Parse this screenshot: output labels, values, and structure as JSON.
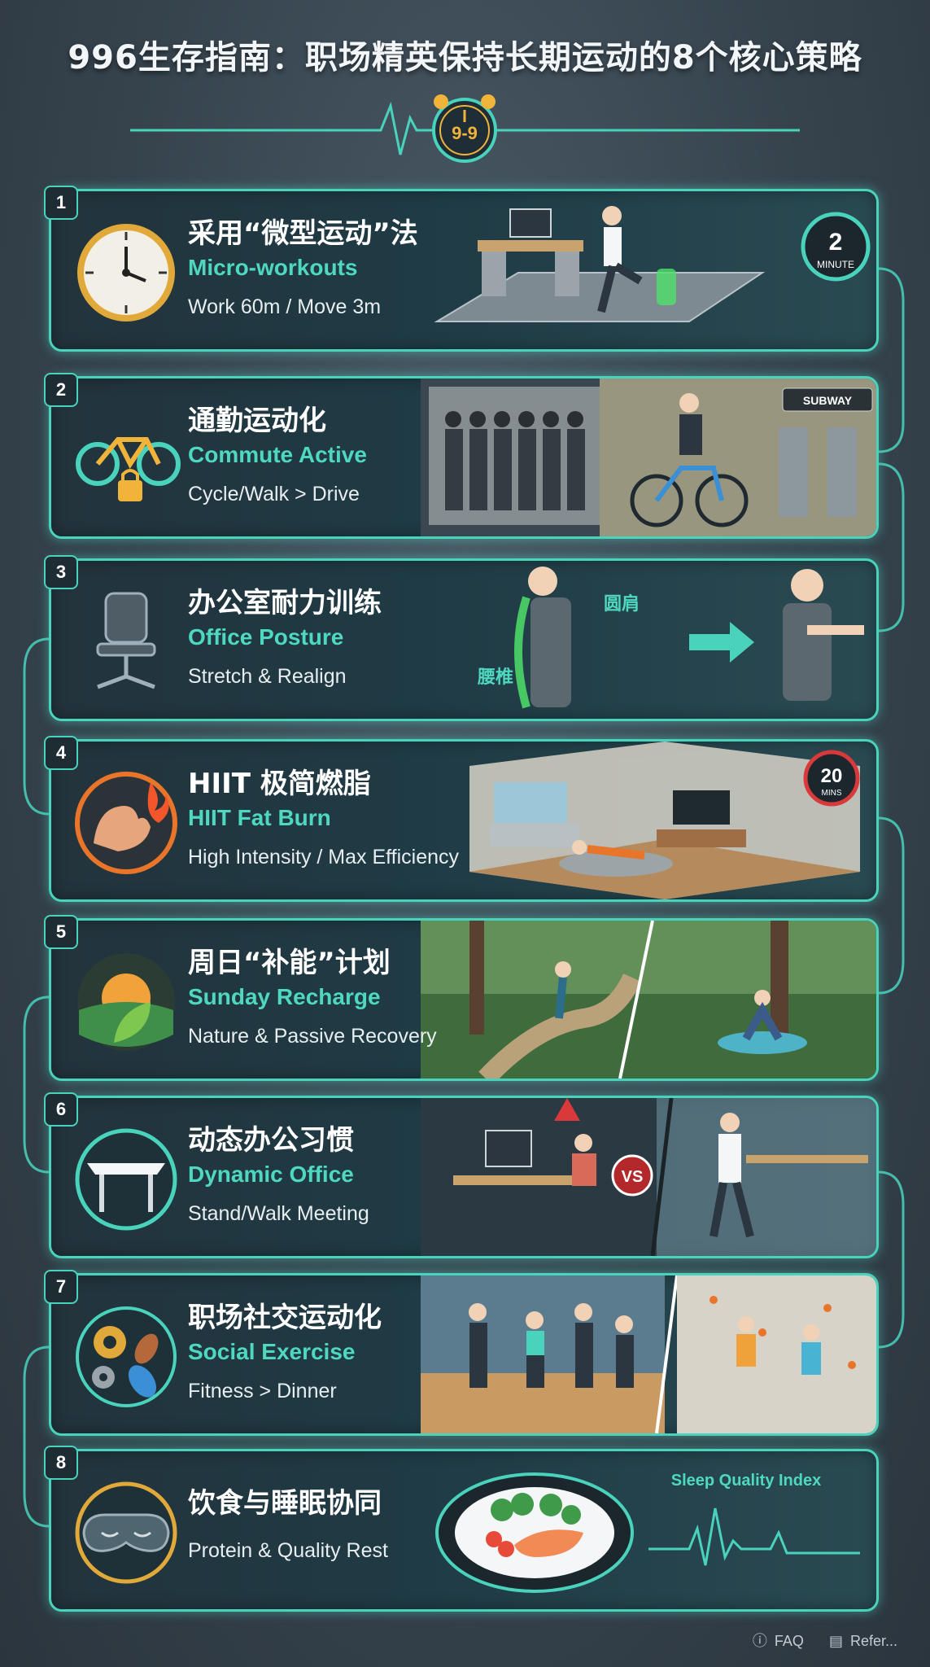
{
  "title": "996生存指南：职场精英保持长期运动的8个核心策略",
  "header": {
    "clock_text": "9-9"
  },
  "colors": {
    "accent": "#49d3bd",
    "accent_text": "#4fd8c0",
    "card_bg": "#23333c",
    "warning": "#d9393b",
    "background": "#3b4852"
  },
  "strategies": [
    {
      "num": "1",
      "zh": "采用“微型运动”法",
      "en": "Micro-workouts",
      "sub": "Work 60m / Move 3m",
      "icon": "clock-icon",
      "scene": {
        "timer_value": "2",
        "timer_unit": "MINUTE"
      }
    },
    {
      "num": "2",
      "zh": "通勤运动化",
      "en": "Commute Active",
      "sub": "Cycle/Walk > Drive",
      "icon": "bicycle-lock-icon",
      "scene": {
        "sign": "SUBWAY"
      }
    },
    {
      "num": "3",
      "zh": "办公室耐力训练",
      "en": "Office Posture",
      "sub": "Stretch & Realign",
      "icon": "office-chair-icon",
      "scene": {
        "label_shoulder": "圆肩",
        "label_spine": "腰椎"
      }
    },
    {
      "num": "4",
      "zh": "HIIT 极简燃脂",
      "en": "HIIT Fat Burn",
      "sub": "High Intensity / Max Efficiency",
      "icon": "flexed-arm-flame-icon",
      "scene": {
        "timer_value": "20",
        "timer_unit": "MINS"
      }
    },
    {
      "num": "5",
      "zh": "周日“补能”计划",
      "en": "Sunday Recharge",
      "sub": "Nature & Passive Recovery",
      "icon": "sunrise-leaf-icon",
      "scene": {}
    },
    {
      "num": "6",
      "zh": "动态办公习惯",
      "en": "Dynamic Office",
      "sub": "Stand/Walk Meeting",
      "icon": "standing-desk-icon",
      "scene": {
        "vs": "VS"
      }
    },
    {
      "num": "7",
      "zh": "职场社交运动化",
      "en": "Social Exercise",
      "sub": "Fitness > Dinner",
      "icon": "gears-sports-icon",
      "scene": {}
    },
    {
      "num": "8",
      "zh": "饮食与睡眠协同",
      "en": "",
      "sub": "Protein & Quality Rest",
      "icon": "sleep-mask-icon",
      "scene": {
        "caption": "Sleep Quality Index"
      }
    }
  ],
  "footer": {
    "faq": "FAQ",
    "ref": "Refer..."
  }
}
